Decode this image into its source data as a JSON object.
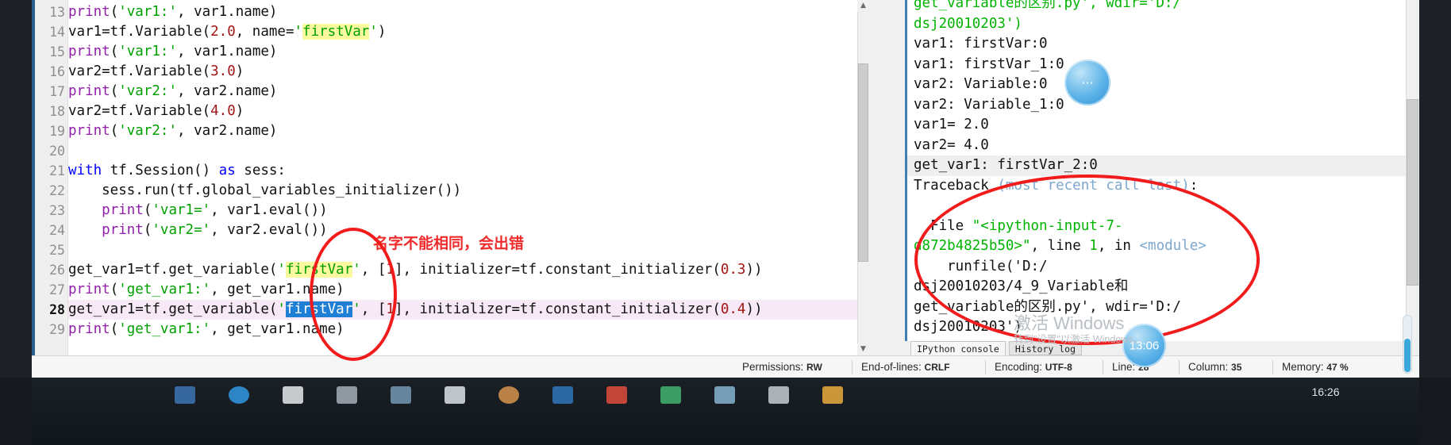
{
  "app": {
    "name": "Spyder IDE"
  },
  "editor": {
    "lines": [
      {
        "num": "13",
        "tokens": [
          {
            "t": "print",
            "c": "fn"
          },
          {
            "t": "(",
            "c": ""
          },
          {
            "t": "'var1:'",
            "c": "str"
          },
          {
            "t": ", var1.name)",
            "c": ""
          }
        ]
      },
      {
        "num": "14",
        "tokens": [
          {
            "t": "var1=tf.Variable(",
            "c": ""
          },
          {
            "t": "2.0",
            "c": "num"
          },
          {
            "t": ", name=",
            "c": ""
          },
          {
            "t": "'",
            "c": "str"
          },
          {
            "t": "firstVar",
            "c": "str hl"
          },
          {
            "t": "'",
            "c": "str"
          },
          {
            "t": ")",
            "c": ""
          }
        ]
      },
      {
        "num": "15",
        "tokens": [
          {
            "t": "print",
            "c": "fn"
          },
          {
            "t": "(",
            "c": ""
          },
          {
            "t": "'var1:'",
            "c": "str"
          },
          {
            "t": ", var1.name)",
            "c": ""
          }
        ]
      },
      {
        "num": "16",
        "tokens": [
          {
            "t": "var2=tf.Variable(",
            "c": ""
          },
          {
            "t": "3.0",
            "c": "num"
          },
          {
            "t": ")",
            "c": ""
          }
        ]
      },
      {
        "num": "17",
        "tokens": [
          {
            "t": "print",
            "c": "fn"
          },
          {
            "t": "(",
            "c": ""
          },
          {
            "t": "'var2:'",
            "c": "str"
          },
          {
            "t": ", var2.name)",
            "c": ""
          }
        ]
      },
      {
        "num": "18",
        "tokens": [
          {
            "t": "var2=tf.Variable(",
            "c": ""
          },
          {
            "t": "4.0",
            "c": "num"
          },
          {
            "t": ")",
            "c": ""
          }
        ]
      },
      {
        "num": "19",
        "tokens": [
          {
            "t": "print",
            "c": "fn"
          },
          {
            "t": "(",
            "c": ""
          },
          {
            "t": "'var2:'",
            "c": "str"
          },
          {
            "t": ", var2.name)",
            "c": ""
          }
        ]
      },
      {
        "num": "20",
        "tokens": [
          {
            "t": "",
            "c": ""
          }
        ]
      },
      {
        "num": "21",
        "tokens": [
          {
            "t": "with",
            "c": "k"
          },
          {
            "t": " tf.Session() ",
            "c": ""
          },
          {
            "t": "as",
            "c": "k"
          },
          {
            "t": " sess:",
            "c": ""
          }
        ]
      },
      {
        "num": "22",
        "tokens": [
          {
            "t": "    sess.run(tf.global_variables_initializer())",
            "c": ""
          }
        ]
      },
      {
        "num": "23",
        "tokens": [
          {
            "t": "    ",
            "c": ""
          },
          {
            "t": "print",
            "c": "fn"
          },
          {
            "t": "(",
            "c": ""
          },
          {
            "t": "'var1='",
            "c": "str"
          },
          {
            "t": ", var1.eval())",
            "c": ""
          }
        ]
      },
      {
        "num": "24",
        "tokens": [
          {
            "t": "    ",
            "c": ""
          },
          {
            "t": "print",
            "c": "fn"
          },
          {
            "t": "(",
            "c": ""
          },
          {
            "t": "'var2='",
            "c": "str"
          },
          {
            "t": ", var2.eval())",
            "c": ""
          }
        ]
      },
      {
        "num": "25",
        "tokens": [
          {
            "t": "",
            "c": ""
          }
        ]
      },
      {
        "num": "26",
        "tokens": [
          {
            "t": "get_var1=tf.get_variable(",
            "c": ""
          },
          {
            "t": "'",
            "c": "str"
          },
          {
            "t": "firstVar",
            "c": "str hl"
          },
          {
            "t": "'",
            "c": "str"
          },
          {
            "t": ", [",
            "c": ""
          },
          {
            "t": "1",
            "c": "num"
          },
          {
            "t": "], initializer=tf.constant_initializer(",
            "c": ""
          },
          {
            "t": "0.3",
            "c": "num"
          },
          {
            "t": "))",
            "c": ""
          }
        ]
      },
      {
        "num": "27",
        "tokens": [
          {
            "t": "print",
            "c": "fn"
          },
          {
            "t": "(",
            "c": ""
          },
          {
            "t": "'get_var1:'",
            "c": "str"
          },
          {
            "t": ", get_var1.name)",
            "c": ""
          }
        ]
      },
      {
        "num": "28",
        "current": true,
        "tokens": [
          {
            "t": "get_var1=tf.get_variable(",
            "c": ""
          },
          {
            "t": "'",
            "c": "str"
          },
          {
            "t": "firstVar",
            "c": "sel"
          },
          {
            "t": "'",
            "c": "str"
          },
          {
            "t": ", [",
            "c": ""
          },
          {
            "t": "1",
            "c": "num"
          },
          {
            "t": "], initializer=tf.constant_initializer(",
            "c": ""
          },
          {
            "t": "0.4",
            "c": "num"
          },
          {
            "t": "))",
            "c": ""
          }
        ]
      },
      {
        "num": "29",
        "tokens": [
          {
            "t": "print",
            "c": "fn"
          },
          {
            "t": "(",
            "c": ""
          },
          {
            "t": "'get_var1:'",
            "c": "str"
          },
          {
            "t": ", get_var1.name)",
            "c": ""
          }
        ]
      }
    ],
    "annotation": "名字不能相同，会出错"
  },
  "console": {
    "lines": [
      {
        "segs": [
          {
            "t": "get_variable的区别.py', wdir='D:/",
            "c": "cgreen"
          }
        ]
      },
      {
        "segs": [
          {
            "t": "dsj20010203')",
            "c": "cgreen"
          }
        ]
      },
      {
        "segs": [
          {
            "t": "var1: firstVar:0",
            "c": ""
          }
        ]
      },
      {
        "segs": [
          {
            "t": "var1: firstVar_1:0",
            "c": ""
          }
        ]
      },
      {
        "segs": [
          {
            "t": "var2: Variable:0",
            "c": ""
          }
        ]
      },
      {
        "segs": [
          {
            "t": "var2: Variable_1:0",
            "c": ""
          }
        ]
      },
      {
        "segs": [
          {
            "t": "var1= 2.0",
            "c": ""
          }
        ]
      },
      {
        "segs": [
          {
            "t": "var2= 4.0",
            "c": ""
          }
        ]
      },
      {
        "highlight": true,
        "segs": [
          {
            "t": "get_var1: firstVar_2:0",
            "c": ""
          }
        ]
      },
      {
        "segs": [
          {
            "t": "Traceback ",
            "c": ""
          },
          {
            "t": "(most recent call last)",
            "c": "cblue"
          },
          {
            "t": ":",
            "c": ""
          }
        ]
      },
      {
        "segs": [
          {
            "t": "",
            "c": ""
          }
        ]
      },
      {
        "segs": [
          {
            "t": "  File ",
            "c": ""
          },
          {
            "t": "\"<ipython-input-7-",
            "c": "cgreen"
          }
        ]
      },
      {
        "segs": [
          {
            "t": "d872b4825b50>\"",
            "c": "cgreen"
          },
          {
            "t": ", line ",
            "c": ""
          },
          {
            "t": "1",
            "c": "cnum"
          },
          {
            "t": ", in ",
            "c": ""
          },
          {
            "t": "<module>",
            "c": "cblue"
          }
        ]
      },
      {
        "segs": [
          {
            "t": "    runfile('D:/",
            "c": ""
          }
        ]
      },
      {
        "segs": [
          {
            "t": "dsj20010203/4_9_Variable和",
            "c": ""
          }
        ]
      },
      {
        "segs": [
          {
            "t": "get_variable的区别.py', wdir='D:/",
            "c": ""
          }
        ]
      },
      {
        "segs": [
          {
            "t": "dsj20010203')",
            "c": ""
          }
        ]
      }
    ],
    "tabs": [
      {
        "label": "IPython console",
        "active": true
      },
      {
        "label": "History log",
        "active": false
      }
    ]
  },
  "statusbar": {
    "items": [
      {
        "label": "Permissions:",
        "value": "RW"
      },
      {
        "label": "End-of-lines:",
        "value": "CRLF"
      },
      {
        "label": "Encoding:",
        "value": "UTF-8"
      },
      {
        "label": "Line:",
        "value": "28"
      },
      {
        "label": "Column:",
        "value": "35"
      },
      {
        "label": "Memory:",
        "value": "47 %"
      }
    ]
  },
  "watermark": {
    "line1": "激活 Windows",
    "line2": "转到\"设置\"以激活 Windows。"
  },
  "overlay": {
    "bubble_top_label": "⋯",
    "bubble_bottom_label": "13:06"
  },
  "taskbar": {
    "clock": "16:26"
  },
  "colors": {
    "accent": "#2b5f8e",
    "annotation_red": "#f21b1b",
    "string_green": "#00a000",
    "keyword_blue": "#0000ff",
    "builtin_purple": "#8f1fa8",
    "number_red": "#a31515",
    "search_highlight": "#fbf9a0",
    "selection_blue": "#1f7fd4",
    "current_line": "#f7e9f5"
  }
}
